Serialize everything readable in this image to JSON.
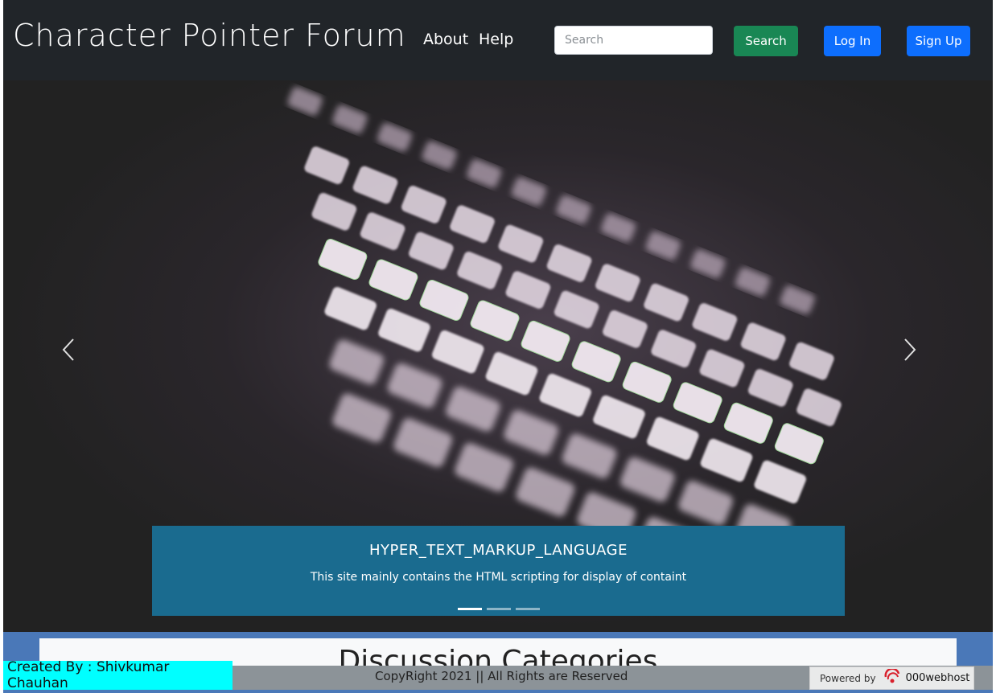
{
  "nav": {
    "brand": "Character Pointer Forum",
    "links": [
      "About",
      "Help"
    ],
    "search_placeholder": "Search",
    "search_button": "Search",
    "login_button": "Log In",
    "signup_button": "Sign Up"
  },
  "carousel": {
    "prev_icon": "chevron-left-icon",
    "next_icon": "chevron-right-icon",
    "caption_title": "HYPER_TEXT_MARKUP_LANGUAGE",
    "caption_text": "This site mainly contains the HTML scripting for display of containt",
    "slide_count": 3,
    "active_slide": 1
  },
  "section": {
    "title": "Discussion Categories"
  },
  "footer": {
    "copyright": "CopyRight 2021 || All Rights are Reserved",
    "created_by": "Created By : Shivkumar Chauhan",
    "powered_label": "Powered by",
    "powered_host": "000webhost"
  },
  "colors": {
    "navbar": "#212529",
    "search_button": "#198754",
    "primary": "#0d6efd",
    "caption_bg": "#1a6b8f",
    "created_bg": "#00ffff",
    "footer_bg": "#8c9398"
  }
}
